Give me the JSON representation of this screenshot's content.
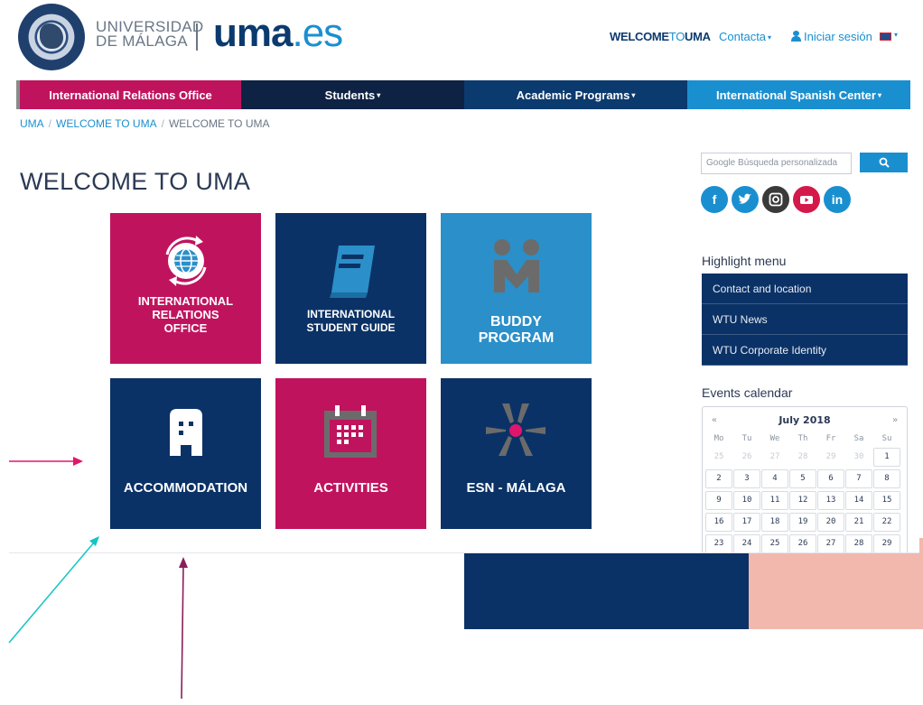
{
  "header": {
    "uni_line1": "UNIVERSIDAD",
    "uni_line2": "DE MÁLAGA",
    "brand_main": "uma",
    "brand_tld": ".es",
    "welcome_bold": "WELCOME",
    "welcome_to": "TO",
    "welcome_uma": "UMA",
    "contact_label": "Contacta",
    "login_label": "Iniciar sesión"
  },
  "main_nav": {
    "items": [
      {
        "label": "International Relations Office"
      },
      {
        "label": "Students"
      },
      {
        "label": "Academic Programs"
      },
      {
        "label": "International Spanish Center"
      }
    ]
  },
  "breadcrumb": {
    "items": [
      "UMA",
      "WELCOME TO UMA",
      "WELCOME TO UMA"
    ]
  },
  "page": {
    "title": "WELCOME TO UMA"
  },
  "tiles": [
    {
      "line1": "INTERNATIONAL",
      "line2": "RELATIONS",
      "line3": "OFFICE",
      "icon": "globe-refresh-icon",
      "color": "#c0135e"
    },
    {
      "line1": "INTERNATIONAL",
      "line2": "STUDENT GUIDE",
      "icon": "book-icon",
      "color": "#0b3266"
    },
    {
      "line1": "BUDDY",
      "line2": "PROGRAM",
      "icon": "buddy-icon",
      "color": "#2b8fc9"
    },
    {
      "line1": "ACCOMMODATION",
      "icon": "building-icon",
      "color": "#0b3266"
    },
    {
      "line1": "ACTIVITIES",
      "icon": "calendar-icon",
      "color": "#c0135e"
    },
    {
      "line1": "ESN - MÁLAGA",
      "icon": "esn-star-icon",
      "color": "#0b3266"
    }
  ],
  "sidebar": {
    "search_placeholder": "Google Búsqueda personalizada",
    "search_button_icon": "search-icon",
    "social": [
      "facebook-icon",
      "twitter-icon",
      "instagram-icon",
      "youtube-icon",
      "linkedin-icon"
    ],
    "highlight_title": "Highlight menu",
    "highlight_items": [
      "Contact and location",
      "WTU News",
      "WTU Corporate Identity"
    ],
    "events_title": "Events calendar"
  },
  "calendar": {
    "month": "July 2018",
    "prev": "«",
    "next": "»",
    "weekdays": [
      "Mo",
      "Tu",
      "We",
      "Th",
      "Fr",
      "Sa",
      "Su"
    ],
    "weeks": [
      [
        "25",
        "26",
        "27",
        "28",
        "29",
        "30",
        "1"
      ],
      [
        "2",
        "3",
        "4",
        "5",
        "6",
        "7",
        "8"
      ],
      [
        "9",
        "10",
        "11",
        "12",
        "13",
        "14",
        "15"
      ],
      [
        "16",
        "17",
        "18",
        "19",
        "20",
        "21",
        "22"
      ],
      [
        "23",
        "24",
        "25",
        "26",
        "27",
        "28",
        "29"
      ]
    ],
    "muted_count": 6
  },
  "colors": {
    "accent_pink": "#c0135e",
    "navy": "#0b3266",
    "sky": "#1a8fd0",
    "peach": "#f2b8ad",
    "annotation_pink": "#e0156b",
    "annotation_teal": "#14c4c4",
    "annotation_plum": "#8a1f5a"
  }
}
